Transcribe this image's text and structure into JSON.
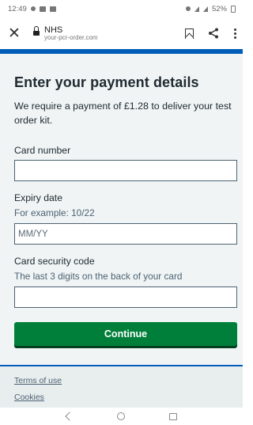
{
  "status_bar": {
    "time": "12:49",
    "battery": "52%"
  },
  "browser": {
    "site_name": "NHS",
    "url": "your-pcr-order.com",
    "icons": [
      "close-icon",
      "lock-icon",
      "bookmark-icon",
      "share-icon",
      "more-vert-icon"
    ]
  },
  "form": {
    "title": "Enter your payment details",
    "intro": "We require a payment of £1.28 to deliver your test order kit.",
    "card_number_label": "Card number",
    "card_number_value": "",
    "expiry_label": "Expiry date",
    "expiry_hint": "For example: 10/22",
    "expiry_placeholder": "MM/YY",
    "security_label": "Card security code",
    "security_hint": "The last 3 digits on the back of your card",
    "security_value": "",
    "continue_label": "Continue"
  },
  "footer": {
    "links": [
      "Terms of use",
      "Cookies"
    ]
  },
  "colors": {
    "nhs_blue": "#005eb8",
    "button_green": "#007f3b",
    "page_background": "#f0f4f5"
  }
}
